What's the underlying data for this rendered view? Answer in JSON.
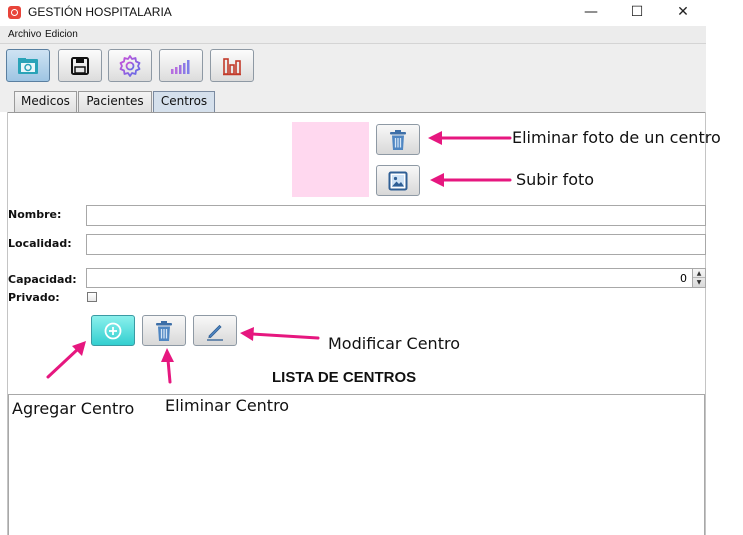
{
  "window": {
    "title": "GESTIÓN HOSPITALARIA",
    "minimize": "—",
    "maximize": "☐",
    "close": "✕"
  },
  "menubar": {
    "items": [
      "Archivo",
      "Edicion"
    ]
  },
  "toolbar": {
    "buttons": [
      {
        "icon": "folder-icon",
        "active": true
      },
      {
        "icon": "save-icon",
        "active": false
      },
      {
        "icon": "settings-gear-icon",
        "active": false
      },
      {
        "icon": "bar-chart-icon",
        "active": false
      },
      {
        "icon": "column-chart-icon",
        "active": false
      }
    ]
  },
  "tabs": [
    {
      "label": "Medicos",
      "selected": false
    },
    {
      "label": "Pacientes",
      "selected": false
    },
    {
      "label": "Centros",
      "selected": true
    }
  ],
  "form": {
    "nombre_label": "Nombre:",
    "localidad_label": "Localidad:",
    "capacidad_label": "Capacidad:",
    "privado_label": "Privado:",
    "nombre_value": "",
    "localidad_value": "",
    "capacidad_value": "0",
    "privado_checked": false
  },
  "photo": {
    "placeholder_color": "#ffd8ef",
    "delete_icon": "trash-icon",
    "upload_icon": "image-icon"
  },
  "actions": {
    "add_icon": "plus-circle-icon",
    "delete_icon": "trash-icon",
    "edit_icon": "pencil-icon"
  },
  "list": {
    "title": "LISTA DE CENTROS",
    "items": []
  },
  "annotations": {
    "arrow_color": "#e6177f",
    "eliminar_foto": "Eliminar foto de un centro",
    "subir_foto": "Subir foto",
    "modificar": "Modificar Centro",
    "agregar": "Agregar Centro",
    "eliminar": "Eliminar Centro"
  }
}
